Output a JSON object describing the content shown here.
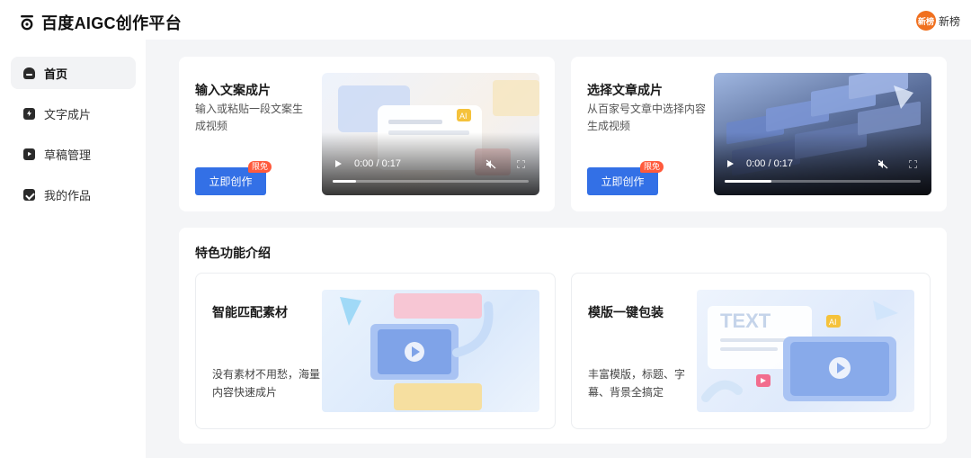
{
  "app": {
    "title": "百度AIGC创作平台"
  },
  "user": {
    "avatar_text": "新榜",
    "name": "新榜"
  },
  "sidebar": {
    "items": [
      {
        "label": "首页",
        "icon": "home-icon",
        "active": true
      },
      {
        "label": "文字成片",
        "icon": "text-to-video-icon",
        "active": false
      },
      {
        "label": "草稿管理",
        "icon": "draft-icon",
        "active": false
      },
      {
        "label": "我的作品",
        "icon": "works-icon",
        "active": false
      }
    ]
  },
  "cards": [
    {
      "title": "输入文案成片",
      "desc": "输入或粘贴一段文案生成视频",
      "button": "立即创作",
      "badge": "限免",
      "video": {
        "time": "0:00 / 0:17",
        "progress": 0.12,
        "thumb_label": "AI"
      }
    },
    {
      "title": "选择文章成片",
      "desc": "从百家号文章中选择内容生成视频",
      "button": "立即创作",
      "badge": "限免",
      "video": {
        "time": "0:00 / 0:17",
        "progress": 0.24
      }
    }
  ],
  "features": {
    "section_title": "特色功能介绍",
    "items": [
      {
        "title": "智能匹配素材",
        "desc": "没有素材不用愁，海量内容快速成片"
      },
      {
        "title": "模版一键包装",
        "desc": "丰富模版，标题、字幕、背景全搞定",
        "image_text": "TEXT",
        "image_badge": "AI"
      }
    ]
  },
  "colors": {
    "primary": "#3370e6",
    "badge": "#ff5a3c",
    "avatar": "#f0701f",
    "page_bg": "#f4f5f7"
  }
}
